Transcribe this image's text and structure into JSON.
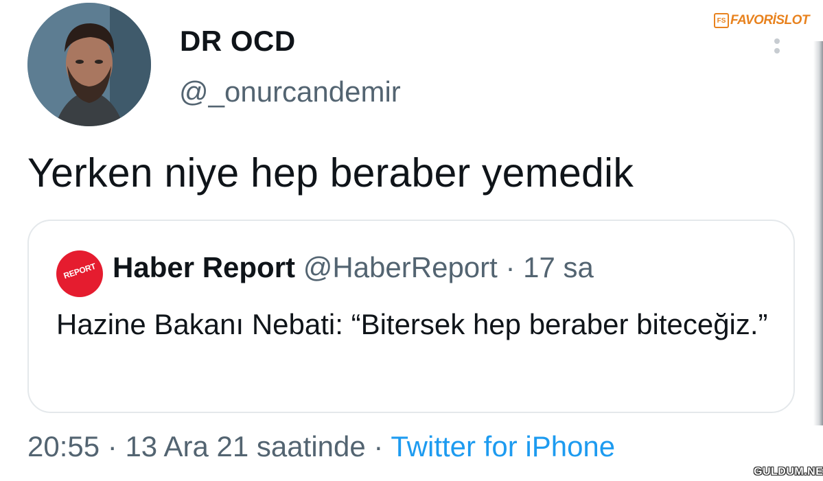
{
  "tweet": {
    "author": {
      "display_name": "DR OCD",
      "handle": "@_onurcandemir",
      "avatar_icon": "profile-photo"
    },
    "text": "Yerken niye hep beraber yemedik",
    "quoted": {
      "display_name": "Haber Report",
      "handle": "@HaberReport",
      "separator": "·",
      "time_ago": "17 sa",
      "avatar_label": "REPORT",
      "text": "Hazine Bakanı Nebati: “Bitersek hep beraber biteceğiz.”"
    },
    "meta": {
      "time": "20:55",
      "separator": "·",
      "date": "13 Ara 21 saatinde",
      "separator2": "·",
      "source": "Twitter for iPhone"
    }
  },
  "watermarks": {
    "top_box": "FS",
    "top": "FAVORİSLOT",
    "bottom": "GULDUM.NET"
  },
  "colors": {
    "text_primary": "#0f1419",
    "text_secondary": "#536471",
    "link": "#1d9bf0",
    "quote_border": "#e4e8eb",
    "watermark_orange": "#e8821e",
    "haber_red": "#e51c2f"
  }
}
